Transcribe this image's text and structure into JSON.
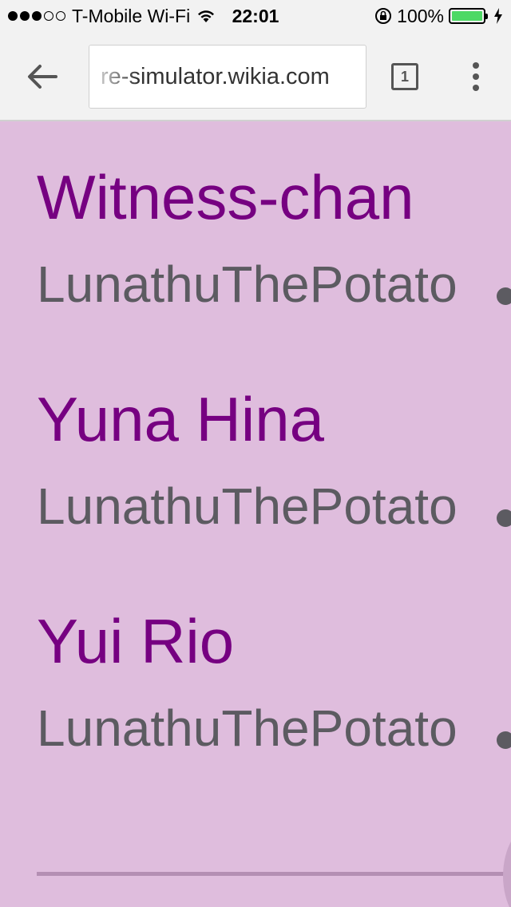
{
  "status_bar": {
    "signal_filled": 3,
    "signal_total": 5,
    "carrier": "T-Mobile Wi-Fi",
    "time": "22:01",
    "battery_percent": "100%",
    "battery_level": 1.0,
    "battery_color": "#4cd964"
  },
  "browser": {
    "url": "re-simulator.wikia.com",
    "tab_count": "1"
  },
  "entries": [
    {
      "name": "Witness-chan",
      "author": "LunathuThePotato"
    },
    {
      "name": "Yuna Hina",
      "author": "LunathuThePotato"
    },
    {
      "name": "Yui Rio",
      "author": "LunathuThePotato"
    }
  ],
  "colors": {
    "background": "#dfbddd",
    "name_text": "#760081",
    "author_text": "#5c5b61"
  }
}
